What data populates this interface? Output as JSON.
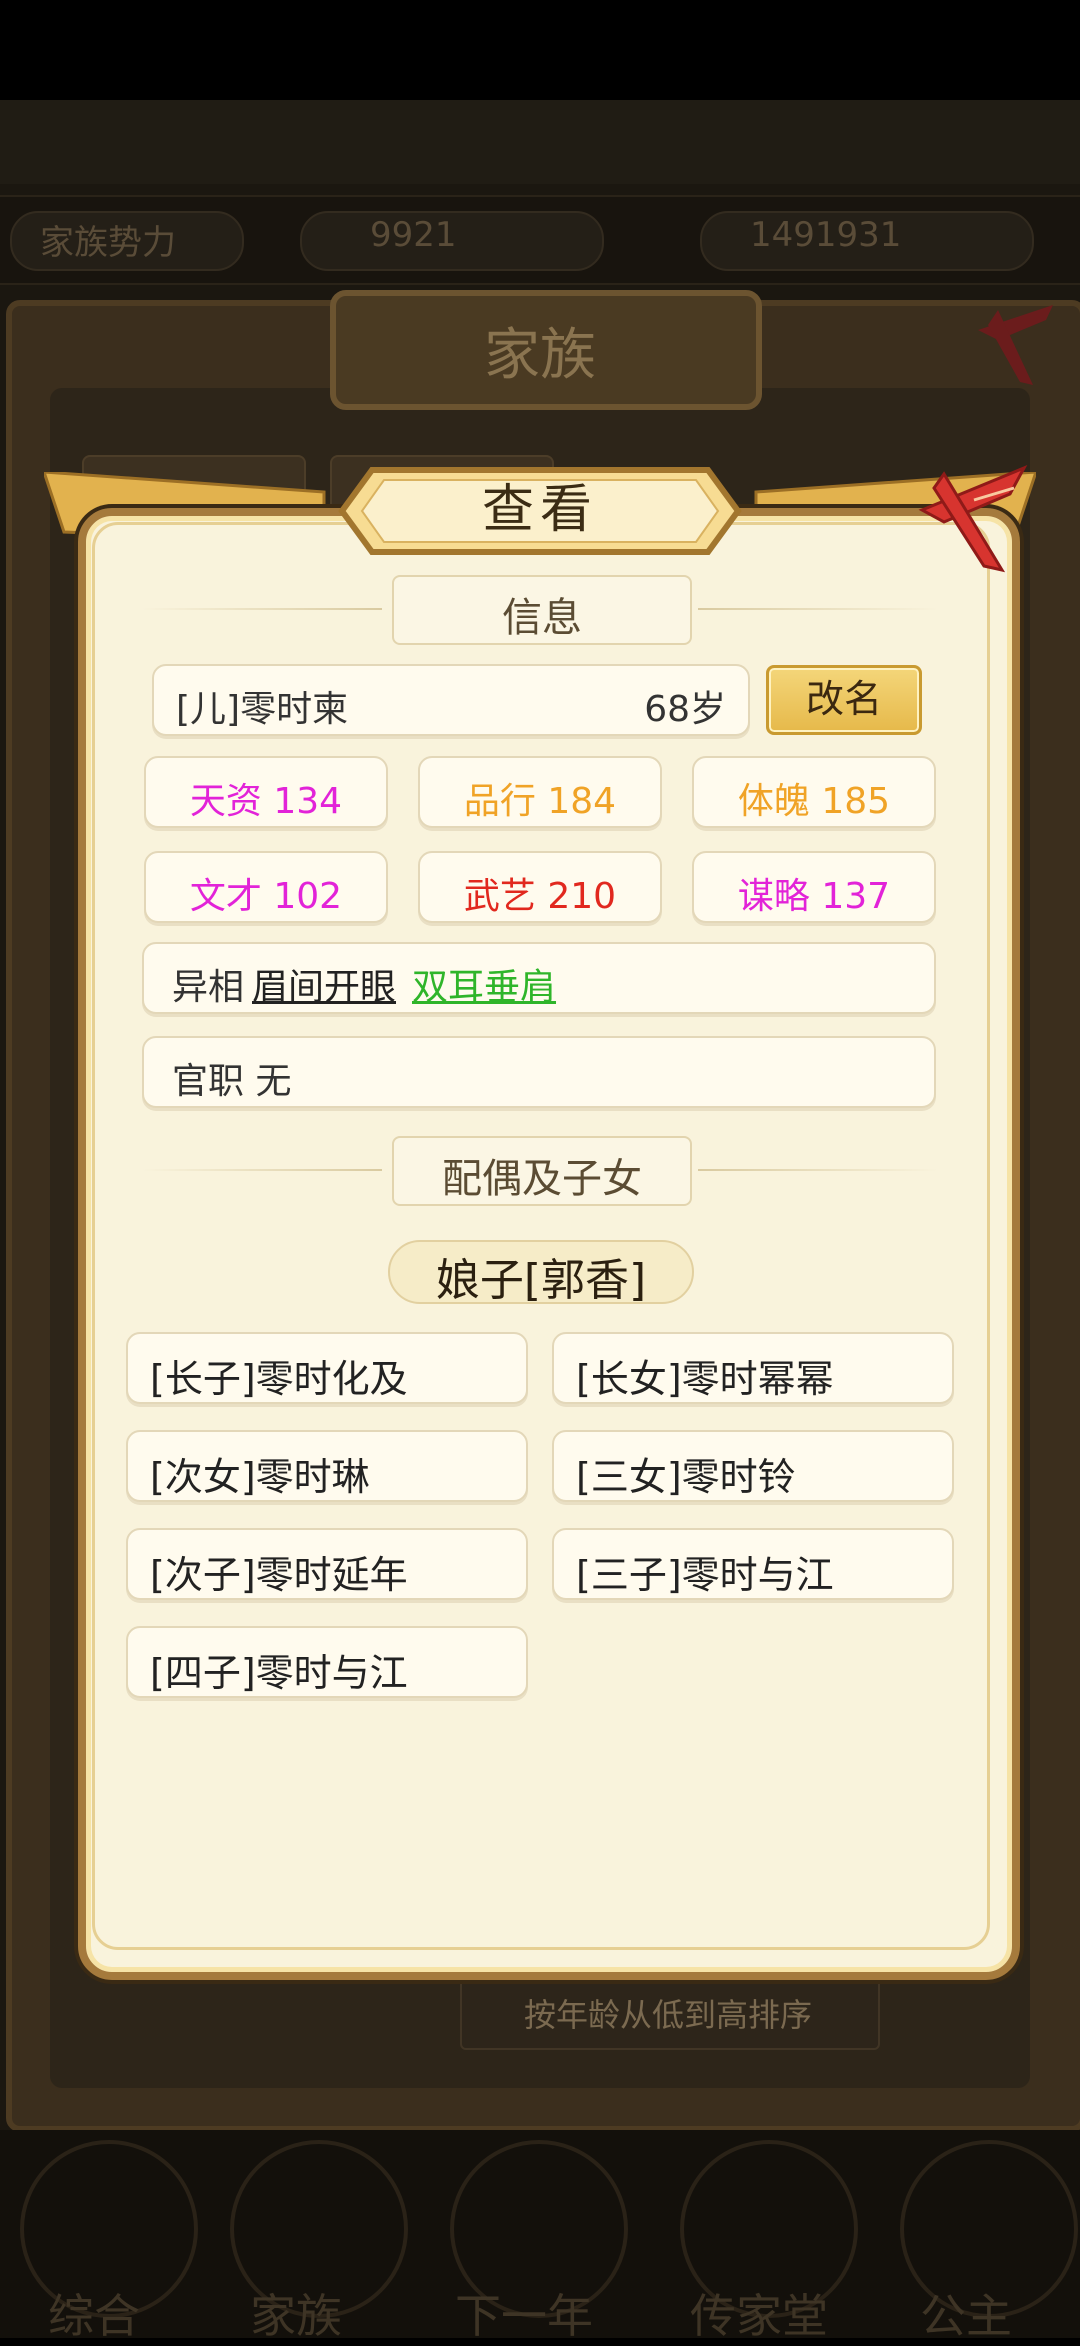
{
  "background": {
    "title": "家族",
    "sort_label": "按年龄从低到高排序",
    "top_info_left": "家族势力",
    "top_info_mid": "9921",
    "top_info_right": "1491931",
    "nav": [
      "综合",
      "家族",
      "下一年",
      "传家堂",
      "公主"
    ]
  },
  "popup": {
    "title": "查看",
    "info_section": "信息",
    "person": {
      "name": "[儿]零时柬",
      "age": "68岁"
    },
    "rename_label": "改名",
    "stats": [
      {
        "label": "天资 134",
        "color": "#e223d8"
      },
      {
        "label": "品行 184",
        "color": "#f0a326"
      },
      {
        "label": "体魄 185",
        "color": "#f0a326"
      },
      {
        "label": "文才 102",
        "color": "#e223d8"
      },
      {
        "label": "武艺 210",
        "color": "#e1281e"
      },
      {
        "label": "谋略 137",
        "color": "#e223d8"
      }
    ],
    "traits_label": "异相",
    "traits": [
      {
        "text": "眉间开眼",
        "color": "#222222"
      },
      {
        "text": "双耳垂肩",
        "color": "#2fb52a"
      }
    ],
    "office_label": "官职 无",
    "family_section": "配偶及子女",
    "spouse": "娘子[郭香]",
    "children": [
      "[长子]零时化及",
      "[长女]零时幂幂",
      "[次女]零时琳",
      "[三女]零时铃",
      "[次子]零时延年",
      "[三子]零时与江",
      "[四子]零时与江"
    ]
  }
}
